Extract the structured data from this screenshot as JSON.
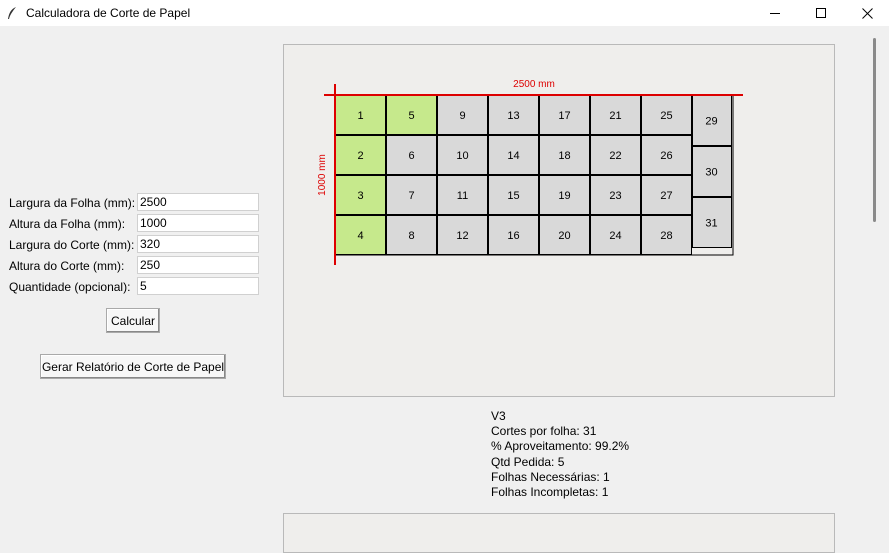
{
  "window": {
    "title": "Calculadora de Corte de Papel"
  },
  "form": {
    "fields": [
      {
        "label": "Largura da Folha (mm):",
        "value": "2500"
      },
      {
        "label": "Altura da Folha (mm):",
        "value": "1000"
      },
      {
        "label": "Largura do Corte (mm):",
        "value": "320"
      },
      {
        "label": "Altura do Corte (mm):",
        "value": "250"
      },
      {
        "label": "Quantidade (opcional):",
        "value": "5"
      }
    ],
    "calcular_label": "Calcular",
    "relatorio_label": "Gerar Relatório de Corte de Papel"
  },
  "diagram": {
    "width_label": "2500 mm",
    "height_label": "1000 mm",
    "colors": {
      "dimension": "#dd0000",
      "highlight": "#c6e98c",
      "piece": "#d9d9d9",
      "border": "#000000"
    },
    "main_grid": [
      [
        "1",
        "5",
        "9",
        "13",
        "17",
        "21",
        "25"
      ],
      [
        "2",
        "6",
        "10",
        "14",
        "18",
        "22",
        "26"
      ],
      [
        "3",
        "7",
        "11",
        "15",
        "19",
        "23",
        "27"
      ],
      [
        "4",
        "8",
        "12",
        "16",
        "20",
        "24",
        "28"
      ]
    ],
    "highlighted": [
      "1",
      "2",
      "3",
      "4",
      "5"
    ],
    "rotated_column": [
      "29",
      "30",
      "31"
    ]
  },
  "results": {
    "lines": [
      "V3",
      "Cortes por folha: 31",
      "% Aproveitamento: 99.2%",
      "Qtd Pedida: 5",
      "Folhas Necessárias: 1",
      "Folhas Incompletas: 1"
    ]
  }
}
